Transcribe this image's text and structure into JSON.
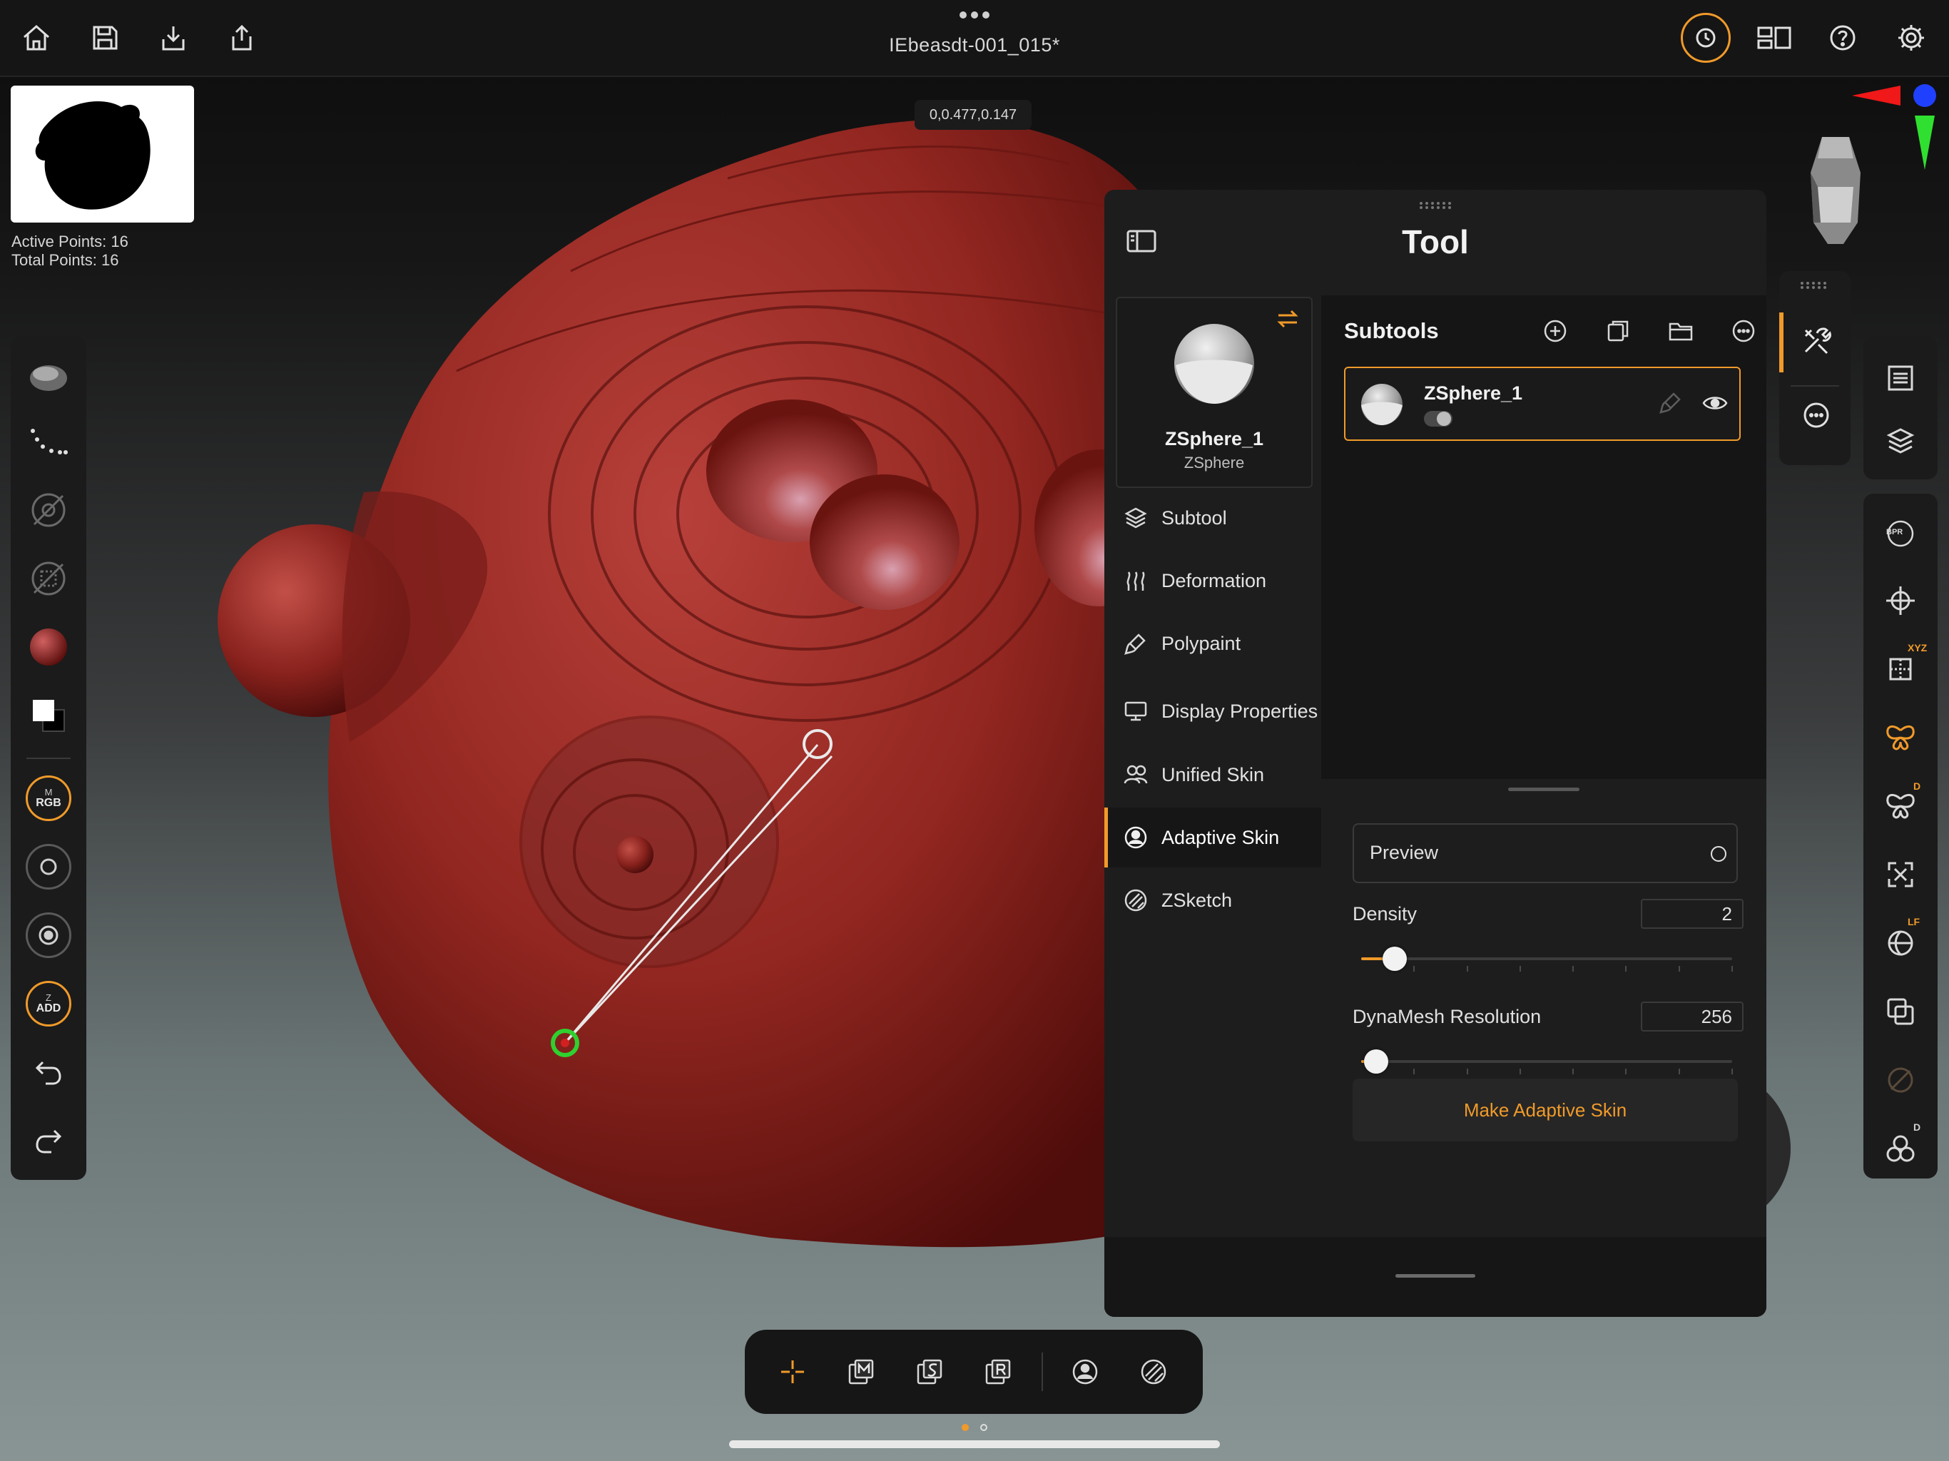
{
  "app": {
    "document_title": "IEbeasdt-001_015*",
    "coordinate_readout": "0,0.477,0.147",
    "active_points": "Active Points: 16",
    "total_points": "Total Points: 16"
  },
  "colors": {
    "accent": "#f09a2a",
    "panel_bg": "#1d1d1d",
    "model_red": "#9c2a24",
    "stroke_green": "#2fd02f"
  },
  "topbar": {
    "left_icons": [
      "home-icon",
      "save-icon",
      "import-icon",
      "export-icon"
    ],
    "right_icons": [
      "history-icon",
      "layout-icon",
      "help-icon",
      "settings-icon"
    ]
  },
  "left_toolbar": {
    "items": [
      {
        "icon": "brush-preview-icon"
      },
      {
        "icon": "stroke-dots-icon"
      },
      {
        "icon": "alpha-off-icon"
      },
      {
        "icon": "texture-off-icon"
      },
      {
        "icon": "material-sphere-icon"
      },
      {
        "icon": "color-swatch-icon"
      },
      {
        "icon": "rgb-mode",
        "sup": "M",
        "label": "RGB"
      },
      {
        "icon": "draw-size-icon"
      },
      {
        "icon": "focal-shift-icon"
      },
      {
        "icon": "zadd-mode",
        "sup": "Z",
        "label": "ADD"
      },
      {
        "icon": "undo-icon"
      },
      {
        "icon": "redo-icon"
      }
    ]
  },
  "right_toolbar": {
    "items": [
      {
        "icon": "tool-list-icon"
      },
      {
        "icon": "layers-icon"
      },
      {
        "icon": "bpr-icon",
        "label": "BPR"
      },
      {
        "icon": "move-gizmo-icon"
      },
      {
        "icon": "floor-grid-icon",
        "sup": "XYZ"
      },
      {
        "icon": "symmetry-butterfly-icon"
      },
      {
        "icon": "radial-symmetry-icon",
        "sup": "D"
      },
      {
        "icon": "frame-icon"
      },
      {
        "icon": "lightbox-icon",
        "sup": "LF"
      },
      {
        "icon": "transparency-icon"
      },
      {
        "icon": "ghost-icon"
      },
      {
        "icon": "solo-icon",
        "sup": "D"
      }
    ]
  },
  "tool_panel": {
    "title": "Tool",
    "current_tool": {
      "name": "ZSphere_1",
      "type": "ZSphere"
    },
    "nav": [
      {
        "label": "Subtool",
        "icon": "subtool-layers-icon",
        "active": false
      },
      {
        "label": "Deformation",
        "icon": "deformation-icon",
        "active": false
      },
      {
        "label": "Polypaint",
        "icon": "polypaint-brush-icon",
        "active": false
      },
      {
        "label": "Display Properties",
        "icon": "display-monitor-icon",
        "active": false
      },
      {
        "label": "Unified Skin",
        "icon": "unified-skin-icon",
        "active": false
      },
      {
        "label": "Adaptive Skin",
        "icon": "adaptive-skin-icon",
        "active": true
      },
      {
        "label": "ZSketch",
        "icon": "zsketch-icon",
        "active": false
      }
    ],
    "subtools": {
      "heading": "Subtools",
      "header_icons": [
        "add-subtool-icon",
        "duplicate-subtool-icon",
        "folder-icon",
        "more-options-icon"
      ],
      "items": [
        {
          "name": "ZSphere_1",
          "visible": true
        }
      ]
    },
    "adaptive_skin": {
      "preview_label": "Preview",
      "preview_on": false,
      "density_label": "Density",
      "density_value": "2",
      "density_fraction": 0.09,
      "dynamesh_label": "DynaMesh Resolution",
      "dynamesh_value": "256",
      "dynamesh_fraction": 0.04,
      "make_button": "Make Adaptive Skin"
    }
  },
  "bottom_toolbar": {
    "items": [
      "draw-zsphere-icon",
      "move-icon",
      "scale-icon",
      "rotate-icon",
      "adaptive-skin-icon",
      "zsketch-icon"
    ]
  }
}
